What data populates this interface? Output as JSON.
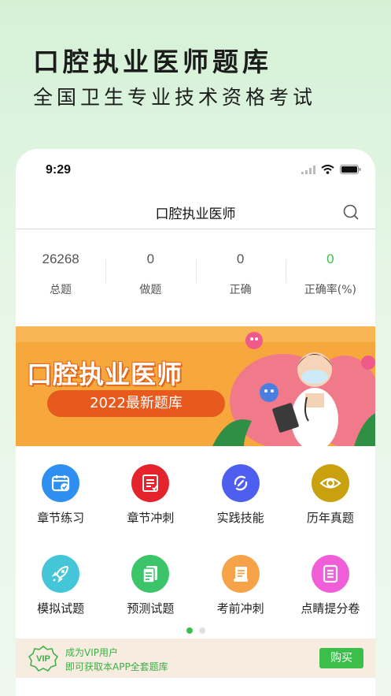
{
  "promo": {
    "title": "口腔执业医师题库",
    "subtitle": "全国卫生专业技术资格考试"
  },
  "status_bar": {
    "time": "9:29"
  },
  "nav": {
    "title": "口腔执业医师",
    "search_icon": "search-icon"
  },
  "stats": [
    {
      "value": "26268",
      "label": "总题"
    },
    {
      "value": "0",
      "label": "做题"
    },
    {
      "value": "0",
      "label": "正确"
    },
    {
      "value": "0",
      "label": "正确率(%)"
    }
  ],
  "banner": {
    "title": "口腔执业医师",
    "pill": "2022最新题库"
  },
  "menu": [
    {
      "label": "章节练习",
      "icon": "calendar-check-icon",
      "color": "#2f8ff0"
    },
    {
      "label": "章节冲刺",
      "icon": "document-edit-icon",
      "color": "#e5232c"
    },
    {
      "label": "实践技能",
      "icon": "swap-icon",
      "color": "#4e5ff0"
    },
    {
      "label": "历年真题",
      "icon": "eye-icon",
      "color": "#c9a10e"
    },
    {
      "label": "模拟试题",
      "icon": "rocket-icon",
      "color": "#45c6d8"
    },
    {
      "label": "预测试题",
      "icon": "documents-icon",
      "color": "#3cc46a"
    },
    {
      "label": "考前冲刺",
      "icon": "scroll-icon",
      "color": "#f5a248"
    },
    {
      "label": "点睛提分卷",
      "icon": "list-icon",
      "color": "#f05fd8"
    }
  ],
  "vip": {
    "badge": "VIP",
    "line1": "成为VIP用户",
    "line2": "即可获取本APP全套题库",
    "buy_label": "购买"
  },
  "colors": {
    "accent": "#3cbf4a",
    "banner_bg": "#f6a53a",
    "pill_bg": "#e8591d"
  }
}
